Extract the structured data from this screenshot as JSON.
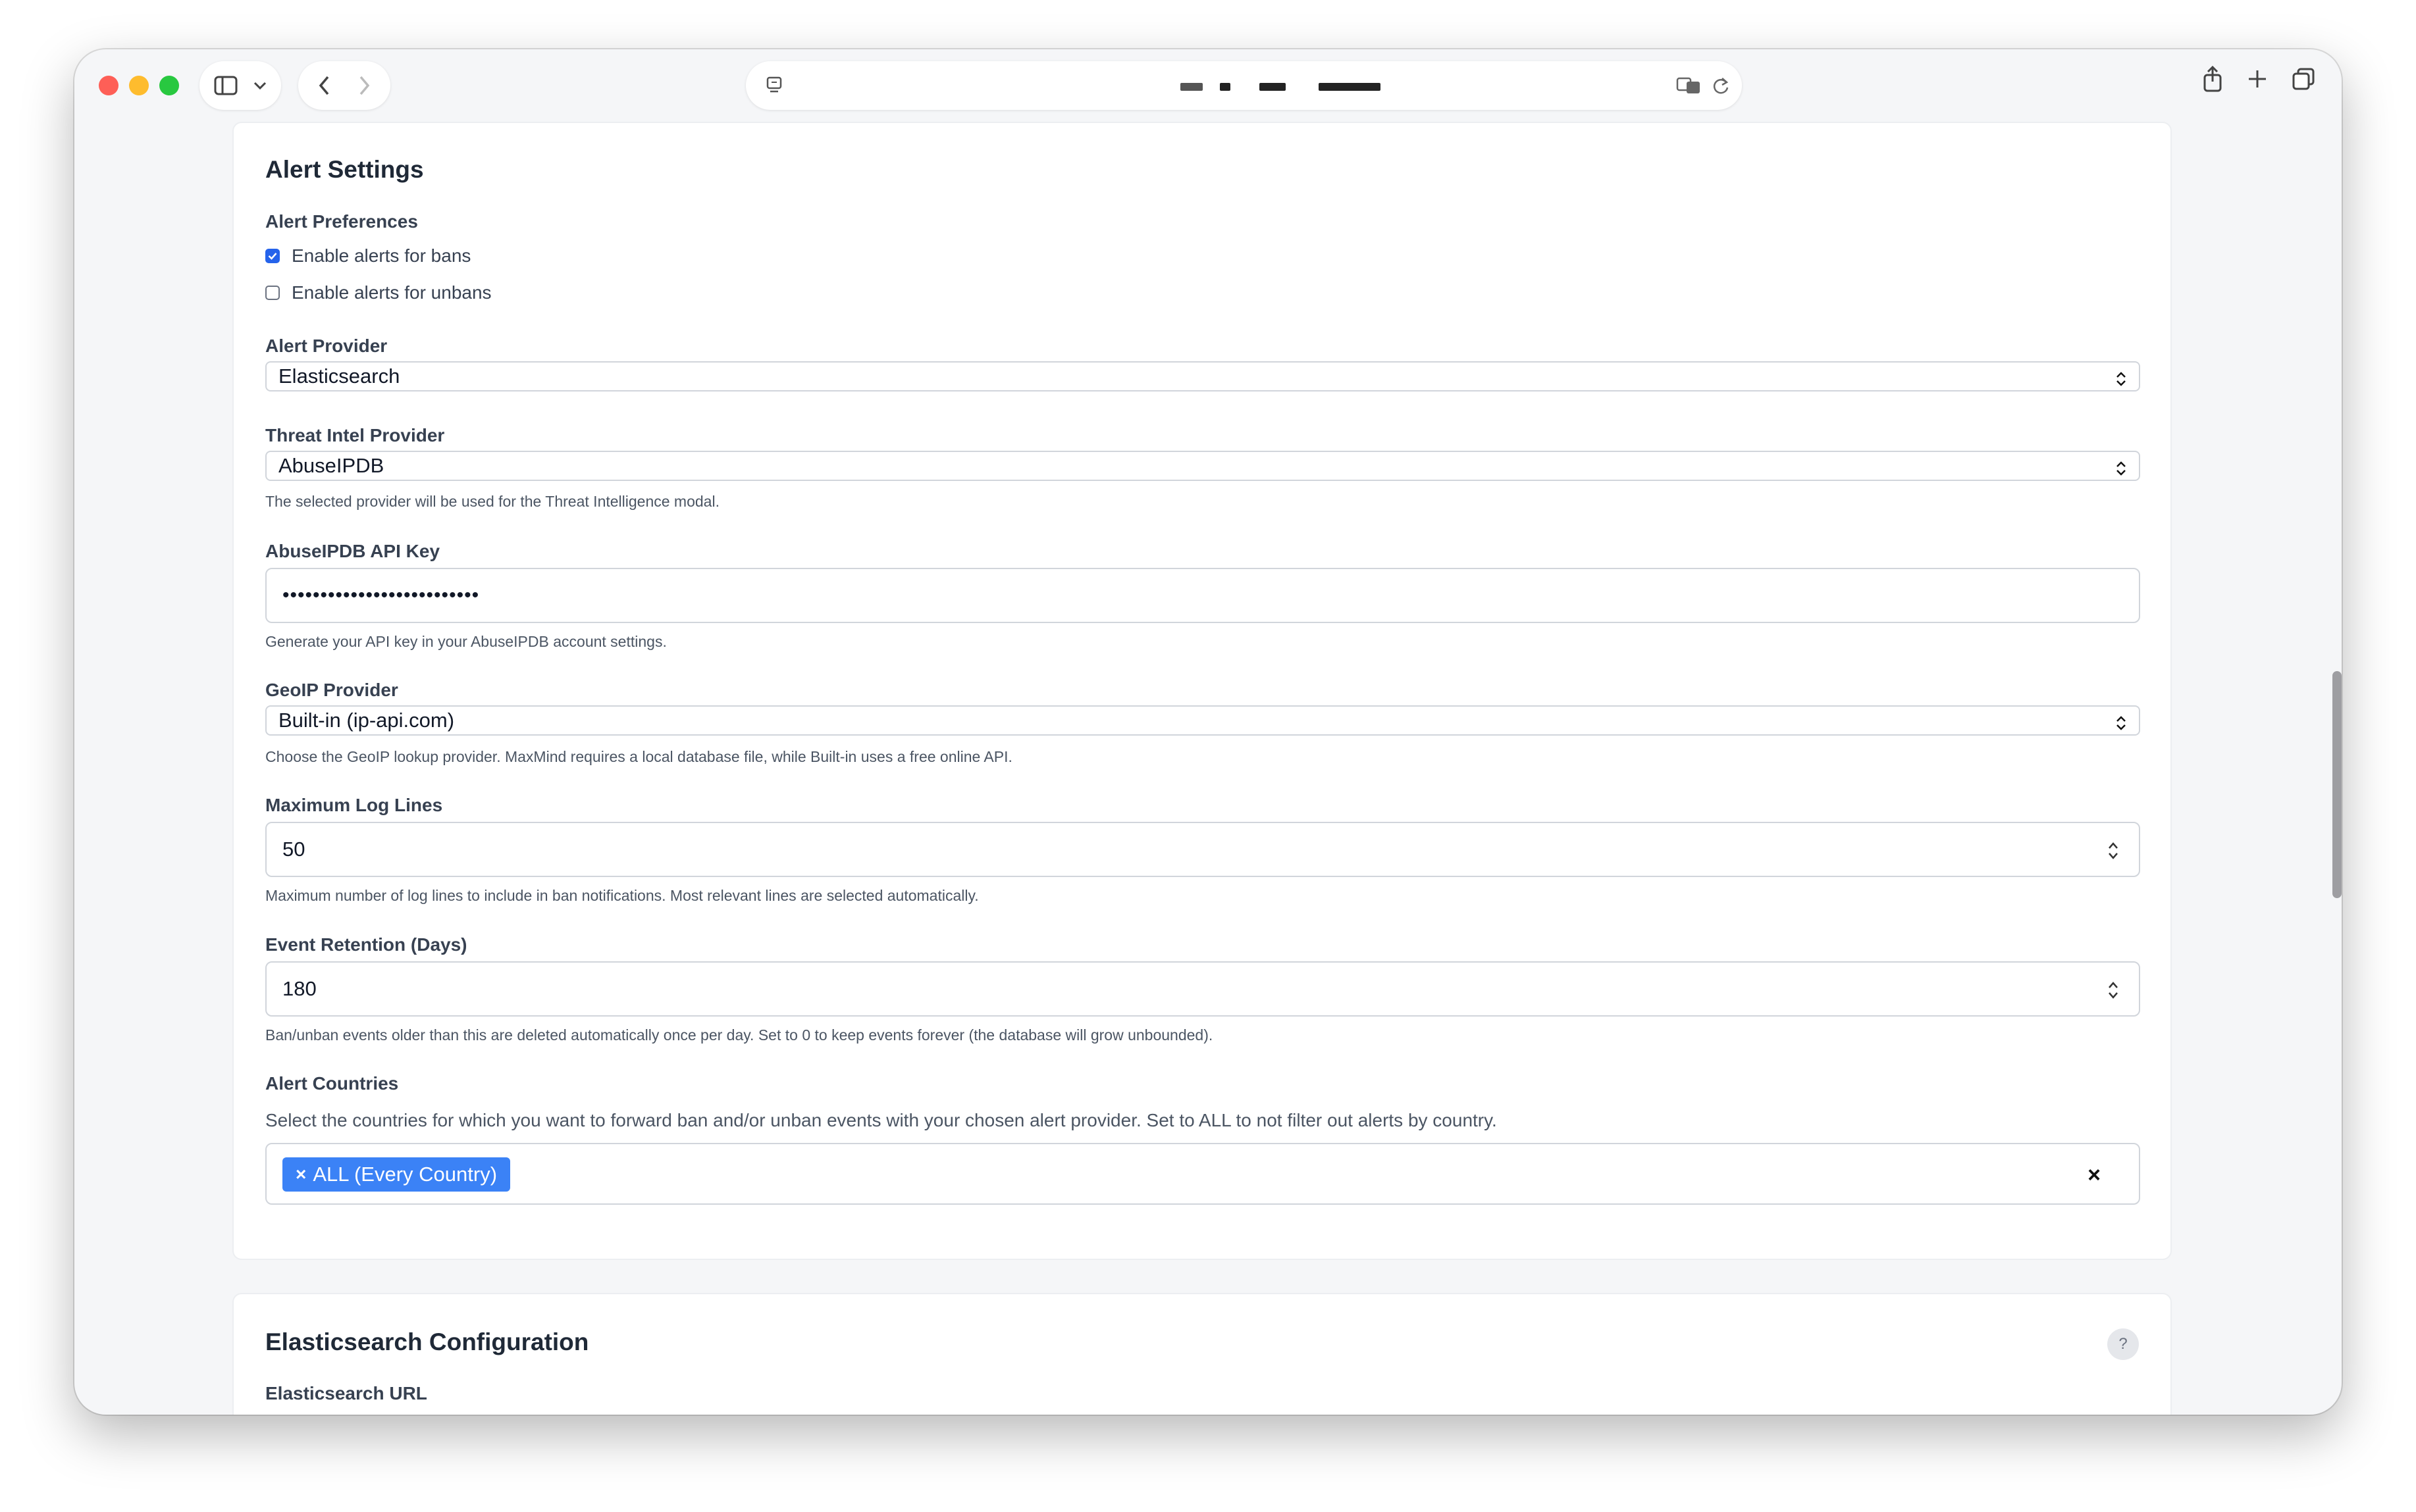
{
  "browser": {
    "url_redacted": true,
    "sidebar_icon": "sidebar-icon",
    "back_icon": "chevron-left-icon",
    "forward_icon": "chevron-right-icon",
    "share_icon": "share-icon",
    "new_tab_icon": "plus-icon",
    "tabs_icon": "tabs-overview-icon"
  },
  "alert_settings": {
    "title": "Alert Settings",
    "preferences_label": "Alert Preferences",
    "checkbox_bans": {
      "label": "Enable alerts for bans",
      "checked": true
    },
    "checkbox_unbans": {
      "label": "Enable alerts for unbans",
      "checked": false
    },
    "alert_provider": {
      "label": "Alert Provider",
      "value": "Elasticsearch"
    },
    "threat_intel": {
      "label": "Threat Intel Provider",
      "value": "AbuseIPDB",
      "help": "The selected provider will be used for the Threat Intelligence modal."
    },
    "api_key": {
      "label": "AbuseIPDB API Key",
      "masked_value": "••••••••••••••••••••••••••",
      "help": "Generate your API key in your AbuseIPDB account settings."
    },
    "geoip": {
      "label": "GeoIP Provider",
      "value": "Built-in (ip-api.com)",
      "help": "Choose the GeoIP lookup provider. MaxMind requires a local database file, while Built-in uses a free online API."
    },
    "max_log_lines": {
      "label": "Maximum Log Lines",
      "value": "50",
      "help": "Maximum number of log lines to include in ban notifications. Most relevant lines are selected automatically."
    },
    "event_retention": {
      "label": "Event Retention (Days)",
      "value": "180",
      "help": "Ban/unban events older than this are deleted automatically once per day. Set to 0 to keep events forever (the database will grow unbounded)."
    },
    "alert_countries": {
      "label": "Alert Countries",
      "description": "Select the countries for which you want to forward ban and/or unban events with your chosen alert provider. Set to ALL to not filter out alerts by country.",
      "selected_tag": "ALL (Every Country)",
      "tag_remove": "×",
      "clear_all": "×"
    }
  },
  "elasticsearch": {
    "title": "Elasticsearch Configuration",
    "help_button": "?",
    "url_label": "Elasticsearch URL"
  }
}
